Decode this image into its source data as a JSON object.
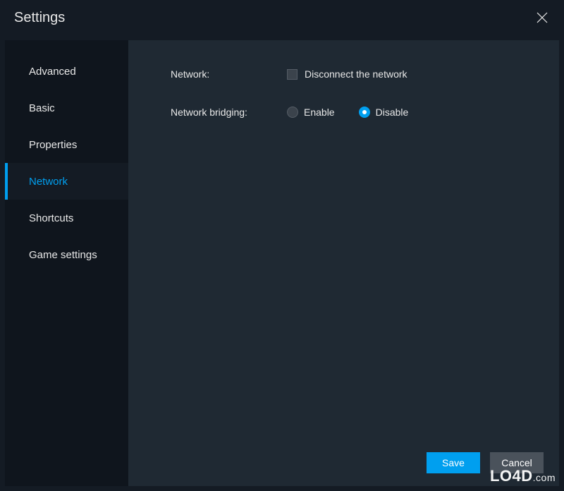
{
  "window": {
    "title": "Settings"
  },
  "sidebar": {
    "items": [
      {
        "label": "Advanced",
        "active": false
      },
      {
        "label": "Basic",
        "active": false
      },
      {
        "label": "Properties",
        "active": false
      },
      {
        "label": "Network",
        "active": true
      },
      {
        "label": "Shortcuts",
        "active": false
      },
      {
        "label": "Game settings",
        "active": false
      }
    ]
  },
  "content": {
    "network_label": "Network:",
    "disconnect_label": "Disconnect the network",
    "bridging_label": "Network bridging:",
    "enable_label": "Enable",
    "disable_label": "Disable"
  },
  "footer": {
    "save_label": "Save",
    "cancel_label": "Cancel"
  },
  "watermark": {
    "brand": "LO4D",
    "suffix": ".com"
  }
}
